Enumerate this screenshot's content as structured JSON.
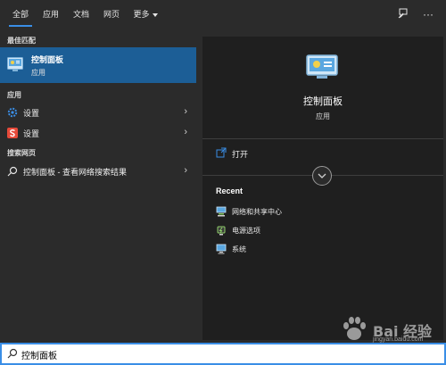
{
  "topnav": {
    "tabs": [
      "全部",
      "应用",
      "文档",
      "网页",
      "更多"
    ],
    "active_tab": "全部",
    "feedback_icon": "feedback-icon",
    "more_icon": "more-options-icon",
    "more_glyph": "···"
  },
  "left": {
    "best_match_title": "最佳匹配",
    "best_match": {
      "name": "控制面板",
      "type": "应用",
      "icon": "control-panel-icon"
    },
    "apps_title": "应用",
    "apps": [
      {
        "label": "设置",
        "icon": "gear-icon",
        "color": "#3a8ee6"
      },
      {
        "label": "设置",
        "icon": "sogou-icon",
        "color": "#e64a3a"
      }
    ],
    "web_title": "搜索网页",
    "web_result": {
      "label": "控制面板 - 查看网络搜索结果",
      "icon": "search-icon"
    }
  },
  "right": {
    "preview": {
      "name": "控制面板",
      "type": "应用",
      "icon": "control-panel-icon"
    },
    "open_label": "打开",
    "recent_title": "Recent",
    "recent": [
      {
        "label": "网络和共享中心",
        "icon": "network-icon"
      },
      {
        "label": "电源选项",
        "icon": "power-options-icon"
      },
      {
        "label": "系统",
        "icon": "system-icon"
      }
    ]
  },
  "search": {
    "value": "控制面板",
    "placeholder": ""
  },
  "watermark": {
    "text": "Bai 经验",
    "sub": "jingyan.baidu.com"
  },
  "colors": {
    "accent": "#3a8ee6",
    "selected": "#1c5e96"
  }
}
